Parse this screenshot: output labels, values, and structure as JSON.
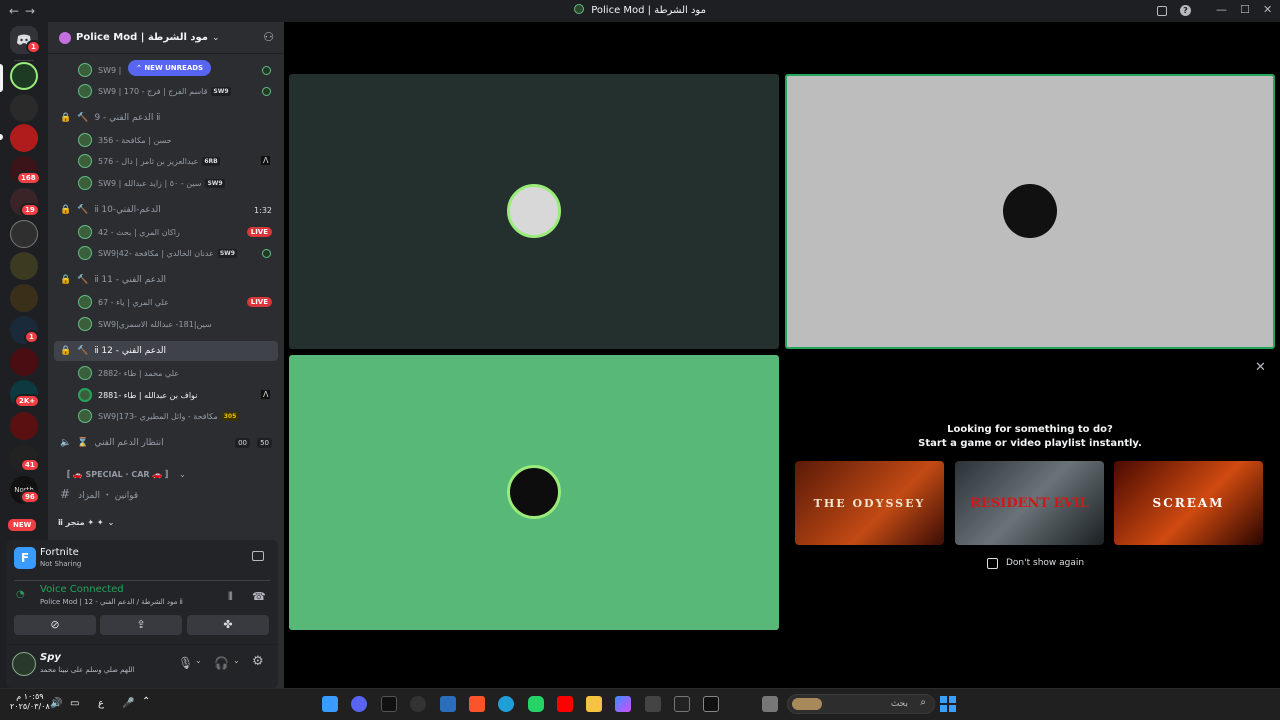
{
  "window": {
    "title": "Police Mod | مود الشرطة",
    "back_glyph": "←",
    "forward_glyph": "→",
    "minimize_glyph": "—",
    "maximize_glyph": "☐",
    "close_glyph": "✕"
  },
  "rail": {
    "badges": [
      "1",
      "168",
      "19",
      "1",
      "2K+",
      "41",
      "96"
    ],
    "new_pill": "NEW",
    "north_label": "North"
  },
  "guild": {
    "name": "Police Mod | مود الشرطة",
    "new_unreads": "NEW UNREADS"
  },
  "channels": [
    {
      "name": "SW9 | ",
      "kind": "user"
    },
    {
      "name": "SW9 | 170 - قاسم الفرج | فرج",
      "tag": "SW9",
      "kind": "user"
    },
    {
      "name": "الدعم الفني - 9 ⅱ",
      "kind": "voice"
    },
    {
      "name": "356 - حسن | مكافحة",
      "kind": "user"
    },
    {
      "name": "576 - عبدالعزيز بن ثامر | دال",
      "tag": "6RB",
      "kind": "user"
    },
    {
      "name": "SW9 | سين - ٥٠ | زايد عبدالله",
      "tag": "SW9",
      "kind": "user"
    },
    {
      "name": "ⅱ الدعم-الفني-10",
      "time": "1:32",
      "kind": "voice"
    },
    {
      "name": "42 - راكان المري | بحث",
      "live": "LIVE",
      "kind": "user"
    },
    {
      "name": "SW9|42- عدنان الخالدي | مكافحة",
      "tag": "SW9",
      "kind": "user"
    },
    {
      "name": "ⅱ الدعم الفني - 11",
      "kind": "voice"
    },
    {
      "name": "67 - علي المري | ياء",
      "live": "LIVE",
      "kind": "user"
    },
    {
      "name": "SW9|سين|181- عبدالله الاسمري",
      "kind": "user"
    },
    {
      "name": "ⅱ الدعم الفني - 12",
      "kind": "voice"
    },
    {
      "name": "2882- علي محمد | طاء",
      "kind": "user"
    },
    {
      "name": "2881- نواف بن عبدالله | طاء",
      "kind": "user"
    },
    {
      "name": "SW9|173- مكافحة - وائل المطيري",
      "tag": "305",
      "kind": "user"
    },
    {
      "name": "انتظار الدعم الفني",
      "counts": [
        "00",
        "50"
      ],
      "kind": "voice"
    },
    {
      "name": "〚 🚗 SPECIAL · CAR 🚗 〛",
      "kind": "category"
    },
    {
      "name": "قوانين ・ المزاد",
      "kind": "text"
    },
    {
      "name": "ⅱ متجر ✦ ✦",
      "kind": "category"
    }
  ],
  "activity_card": {
    "title": "Fortnite",
    "subtitle": "Not Sharing"
  },
  "voice": {
    "status": "Voice Connected",
    "location": "Police Mod | مود الشرطة / الدعم الفني - 12 ⅱ"
  },
  "user": {
    "name": "Spy",
    "status": "اللهم صلي وسلم على نبينا محمد"
  },
  "stage": {
    "prompt_line1": "Looking for something to do?",
    "prompt_line2": "Start a game or video playlist instantly.",
    "dont_show": "Don't show again",
    "games": [
      {
        "title": "THE ODYSSEY"
      },
      {
        "title": "RESIDENT EVIL"
      },
      {
        "title": "SCREAM"
      }
    ]
  },
  "taskbar": {
    "time": "١٠:٥٩ م",
    "date": "٢٠٢٥/٠٣/٠٨",
    "lang": "ع",
    "search_placeholder": "بحث"
  },
  "colors": {
    "accent_green": "#9aec7a",
    "voice_green": "#23a55a",
    "live_red": "#da373c"
  }
}
